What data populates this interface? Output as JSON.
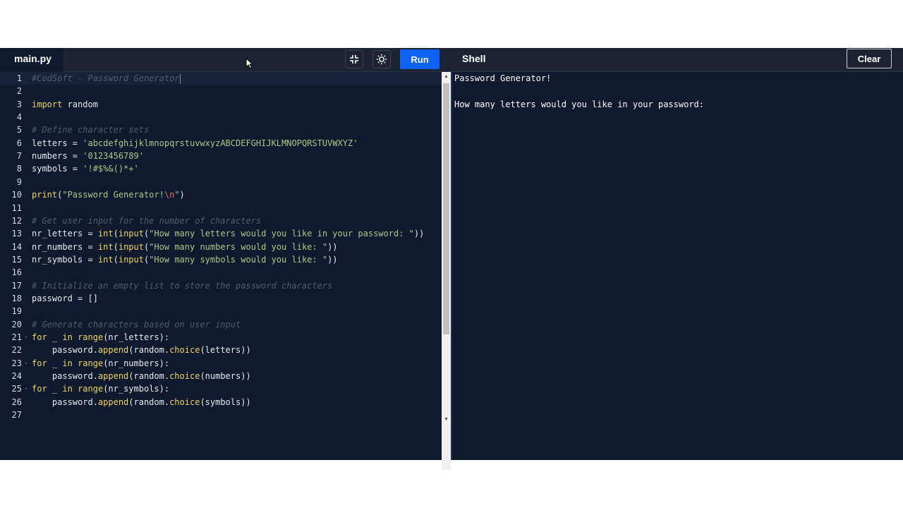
{
  "editor": {
    "file_tab": "main.py",
    "run_label": "Run",
    "icons": {
      "exit_fullscreen": "minimize-icon",
      "theme": "sun-icon"
    },
    "lines": [
      {
        "num": "1",
        "tokens": [
          {
            "t": "#CodSoft - Password Generator",
            "c": "comment"
          }
        ],
        "active": true,
        "cursor": true
      },
      {
        "num": "2",
        "tokens": []
      },
      {
        "num": "3",
        "tokens": [
          {
            "t": "import",
            "c": "kw"
          },
          {
            "t": " random",
            "c": "plain"
          }
        ]
      },
      {
        "num": "4",
        "tokens": []
      },
      {
        "num": "5",
        "tokens": [
          {
            "t": "# Define character sets",
            "c": "comment"
          }
        ]
      },
      {
        "num": "6",
        "tokens": [
          {
            "t": "letters = ",
            "c": "plain"
          },
          {
            "t": "'abcdefghijklmnopqrstuvwxyzABCDEFGHIJKLMNOPQRSTUVWXYZ'",
            "c": "string"
          }
        ]
      },
      {
        "num": "7",
        "tokens": [
          {
            "t": "numbers = ",
            "c": "plain"
          },
          {
            "t": "'0123456789'",
            "c": "string"
          }
        ]
      },
      {
        "num": "8",
        "tokens": [
          {
            "t": "symbols = ",
            "c": "plain"
          },
          {
            "t": "'!#$%&()*+'",
            "c": "string"
          }
        ]
      },
      {
        "num": "9",
        "tokens": []
      },
      {
        "num": "10",
        "tokens": [
          {
            "t": "print",
            "c": "func"
          },
          {
            "t": "(",
            "c": "plain"
          },
          {
            "t": "\"Password Generator!",
            "c": "string"
          },
          {
            "t": "\\n",
            "c": "esc"
          },
          {
            "t": "\"",
            "c": "string"
          },
          {
            "t": ")",
            "c": "plain"
          }
        ]
      },
      {
        "num": "11",
        "tokens": []
      },
      {
        "num": "12",
        "tokens": [
          {
            "t": "# Get user input for the number of characters",
            "c": "comment"
          }
        ]
      },
      {
        "num": "13",
        "tokens": [
          {
            "t": "nr_letters = ",
            "c": "plain"
          },
          {
            "t": "int",
            "c": "func"
          },
          {
            "t": "(",
            "c": "plain"
          },
          {
            "t": "input",
            "c": "func"
          },
          {
            "t": "(",
            "c": "plain"
          },
          {
            "t": "\"How many letters would you like in your password: \"",
            "c": "string"
          },
          {
            "t": "))",
            "c": "plain"
          }
        ]
      },
      {
        "num": "14",
        "tokens": [
          {
            "t": "nr_numbers = ",
            "c": "plain"
          },
          {
            "t": "int",
            "c": "func"
          },
          {
            "t": "(",
            "c": "plain"
          },
          {
            "t": "input",
            "c": "func"
          },
          {
            "t": "(",
            "c": "plain"
          },
          {
            "t": "\"How many numbers would you like: \"",
            "c": "string"
          },
          {
            "t": "))",
            "c": "plain"
          }
        ]
      },
      {
        "num": "15",
        "tokens": [
          {
            "t": "nr_symbols = ",
            "c": "plain"
          },
          {
            "t": "int",
            "c": "func"
          },
          {
            "t": "(",
            "c": "plain"
          },
          {
            "t": "input",
            "c": "func"
          },
          {
            "t": "(",
            "c": "plain"
          },
          {
            "t": "\"How many symbols would you like: \"",
            "c": "string"
          },
          {
            "t": "))",
            "c": "plain"
          }
        ]
      },
      {
        "num": "16",
        "tokens": []
      },
      {
        "num": "17",
        "tokens": [
          {
            "t": "# Initialize an empty list to store the password characters",
            "c": "comment"
          }
        ]
      },
      {
        "num": "18",
        "tokens": [
          {
            "t": "password = []",
            "c": "plain"
          }
        ]
      },
      {
        "num": "19",
        "tokens": []
      },
      {
        "num": "20",
        "tokens": [
          {
            "t": "# Generate characters based on user input",
            "c": "comment"
          }
        ]
      },
      {
        "num": "21",
        "tokens": [
          {
            "t": "for",
            "c": "kw"
          },
          {
            "t": " _ ",
            "c": "plain"
          },
          {
            "t": "in",
            "c": "kw"
          },
          {
            "t": " ",
            "c": "plain"
          },
          {
            "t": "range",
            "c": "func"
          },
          {
            "t": "(nr_letters):",
            "c": "plain"
          }
        ],
        "fold": true
      },
      {
        "num": "22",
        "tokens": [
          {
            "t": "    password.",
            "c": "plain"
          },
          {
            "t": "append",
            "c": "func"
          },
          {
            "t": "(random.",
            "c": "plain"
          },
          {
            "t": "choice",
            "c": "func"
          },
          {
            "t": "(letters))",
            "c": "plain"
          }
        ]
      },
      {
        "num": "23",
        "tokens": [
          {
            "t": "for",
            "c": "kw"
          },
          {
            "t": " _ ",
            "c": "plain"
          },
          {
            "t": "in",
            "c": "kw"
          },
          {
            "t": " ",
            "c": "plain"
          },
          {
            "t": "range",
            "c": "func"
          },
          {
            "t": "(nr_numbers):",
            "c": "plain"
          }
        ],
        "fold": true
      },
      {
        "num": "24",
        "tokens": [
          {
            "t": "    password.",
            "c": "plain"
          },
          {
            "t": "append",
            "c": "func"
          },
          {
            "t": "(random.",
            "c": "plain"
          },
          {
            "t": "choice",
            "c": "func"
          },
          {
            "t": "(numbers))",
            "c": "plain"
          }
        ]
      },
      {
        "num": "25",
        "tokens": [
          {
            "t": "for",
            "c": "kw"
          },
          {
            "t": " _ ",
            "c": "plain"
          },
          {
            "t": "in",
            "c": "kw"
          },
          {
            "t": " ",
            "c": "plain"
          },
          {
            "t": "range",
            "c": "func"
          },
          {
            "t": "(nr_symbols):",
            "c": "plain"
          }
        ],
        "fold": true
      },
      {
        "num": "26",
        "tokens": [
          {
            "t": "    password.",
            "c": "plain"
          },
          {
            "t": "append",
            "c": "func"
          },
          {
            "t": "(random.",
            "c": "plain"
          },
          {
            "t": "choice",
            "c": "func"
          },
          {
            "t": "(symbols))",
            "c": "plain"
          }
        ]
      },
      {
        "num": "27",
        "tokens": []
      }
    ]
  },
  "shell": {
    "title": "Shell",
    "clear_label": "Clear",
    "output": [
      "Password Generator!",
      "",
      "How many letters would you like in your password: "
    ]
  },
  "colors": {
    "background": "#0f1a2e",
    "topbar": "#1c2433",
    "run_button": "#0d62f2",
    "keyword": "#f0d264",
    "string": "#a9c98b",
    "comment": "#4e5b72",
    "escape": "#e06c6c"
  }
}
